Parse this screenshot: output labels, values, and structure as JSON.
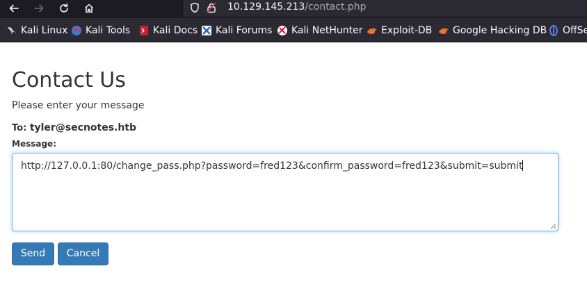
{
  "browser": {
    "url_host": "10.129.145.213",
    "url_path": "/contact.php",
    "bookmarks": [
      {
        "label": "Kali Linux",
        "icon": "kali-dragon-icon"
      },
      {
        "label": "Kali Tools",
        "icon": "kali-tools-icon"
      },
      {
        "label": "Kali Docs",
        "icon": "kali-docs-icon"
      },
      {
        "label": "Kali Forums",
        "icon": "kali-forums-icon"
      },
      {
        "label": "Kali NetHunter",
        "icon": "kali-nethunter-icon"
      },
      {
        "label": "Exploit-DB",
        "icon": "exploit-db-icon"
      },
      {
        "label": "Google Hacking DB",
        "icon": "ghdb-icon"
      },
      {
        "label": "OffSe",
        "icon": "offsec-icon"
      }
    ]
  },
  "page": {
    "title": "Contact Us",
    "subtitle": "Please enter your message",
    "to_label": "To:",
    "to_address": "tyler@secnotes.htb",
    "message_label": "Message:",
    "message_value": "http://127.0.0.1:80/change_pass.php?password=fred123&confirm_password=fred123&submit=submit",
    "send_label": "Send",
    "cancel_label": "Cancel"
  },
  "colors": {
    "button": "#337ab7",
    "focus_border": "#66afe9",
    "chrome_dark": "#1c1b22",
    "bookmarks_bar": "#2b2a33"
  }
}
